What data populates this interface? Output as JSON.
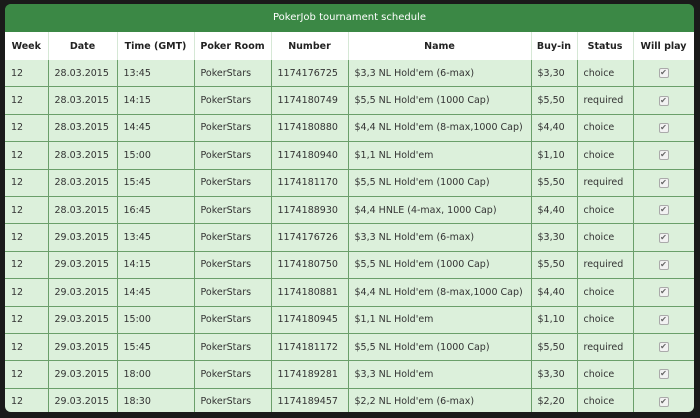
{
  "title": "PokerJob tournament schedule",
  "columns": [
    "Week",
    "Date",
    "Time (GMT)",
    "Poker Room",
    "Number",
    "Name",
    "Buy-in",
    "Status",
    "Will play"
  ],
  "rows": [
    {
      "week": "12",
      "date": "28.03.2015",
      "time": "13:45",
      "room": "PokerStars",
      "number": "1174176725",
      "name": "$3,3 NL Hold'em (6-max)",
      "buyin": "$3,30",
      "status": "choice",
      "will_play": true
    },
    {
      "week": "12",
      "date": "28.03.2015",
      "time": "14:15",
      "room": "PokerStars",
      "number": "1174180749",
      "name": "$5,5 NL Hold'em (1000 Cap)",
      "buyin": "$5,50",
      "status": "required",
      "will_play": true
    },
    {
      "week": "12",
      "date": "28.03.2015",
      "time": "14:45",
      "room": "PokerStars",
      "number": "1174180880",
      "name": "$4,4 NL Hold'em (8-max,1000 Cap)",
      "buyin": "$4,40",
      "status": "choice",
      "will_play": true
    },
    {
      "week": "12",
      "date": "28.03.2015",
      "time": "15:00",
      "room": "PokerStars",
      "number": "1174180940",
      "name": "$1,1 NL Hold'em",
      "buyin": "$1,10",
      "status": "choice",
      "will_play": true
    },
    {
      "week": "12",
      "date": "28.03.2015",
      "time": "15:45",
      "room": "PokerStars",
      "number": "1174181170",
      "name": "$5,5 NL Hold'em (1000 Cap)",
      "buyin": "$5,50",
      "status": "required",
      "will_play": true
    },
    {
      "week": "12",
      "date": "28.03.2015",
      "time": "16:45",
      "room": "PokerStars",
      "number": "1174188930",
      "name": "$4,4 HNLE (4-max, 1000 Cap)",
      "buyin": "$4,40",
      "status": "choice",
      "will_play": true
    },
    {
      "week": "12",
      "date": "29.03.2015",
      "time": "13:45",
      "room": "PokerStars",
      "number": "1174176726",
      "name": "$3,3 NL Hold'em (6-max)",
      "buyin": "$3,30",
      "status": "choice",
      "will_play": true
    },
    {
      "week": "12",
      "date": "29.03.2015",
      "time": "14:15",
      "room": "PokerStars",
      "number": "1174180750",
      "name": "$5,5 NL Hold'em (1000 Cap)",
      "buyin": "$5,50",
      "status": "required",
      "will_play": true
    },
    {
      "week": "12",
      "date": "29.03.2015",
      "time": "14:45",
      "room": "PokerStars",
      "number": "1174180881",
      "name": "$4,4 NL Hold'em (8-max,1000 Cap)",
      "buyin": "$4,40",
      "status": "choice",
      "will_play": true
    },
    {
      "week": "12",
      "date": "29.03.2015",
      "time": "15:00",
      "room": "PokerStars",
      "number": "1174180945",
      "name": "$1,1 NL Hold'em",
      "buyin": "$1,10",
      "status": "choice",
      "will_play": true
    },
    {
      "week": "12",
      "date": "29.03.2015",
      "time": "15:45",
      "room": "PokerStars",
      "number": "1174181172",
      "name": "$5,5 NL Hold'em (1000 Cap)",
      "buyin": "$5,50",
      "status": "required",
      "will_play": true
    },
    {
      "week": "12",
      "date": "29.03.2015",
      "time": "18:00",
      "room": "PokerStars",
      "number": "1174189281",
      "name": "$3,3 NL Hold'em",
      "buyin": "$3,30",
      "status": "choice",
      "will_play": true
    },
    {
      "week": "12",
      "date": "29.03.2015",
      "time": "18:30",
      "room": "PokerStars",
      "number": "1174189457",
      "name": "$2,2 NL Hold'em (6-max)",
      "buyin": "$2,20",
      "status": "choice",
      "will_play": true
    }
  ],
  "checkbox_glyph": "✔",
  "colors": {
    "header_green": "#3b8845",
    "row_bg": "#dcf0db",
    "border": "#6a9f6a"
  }
}
